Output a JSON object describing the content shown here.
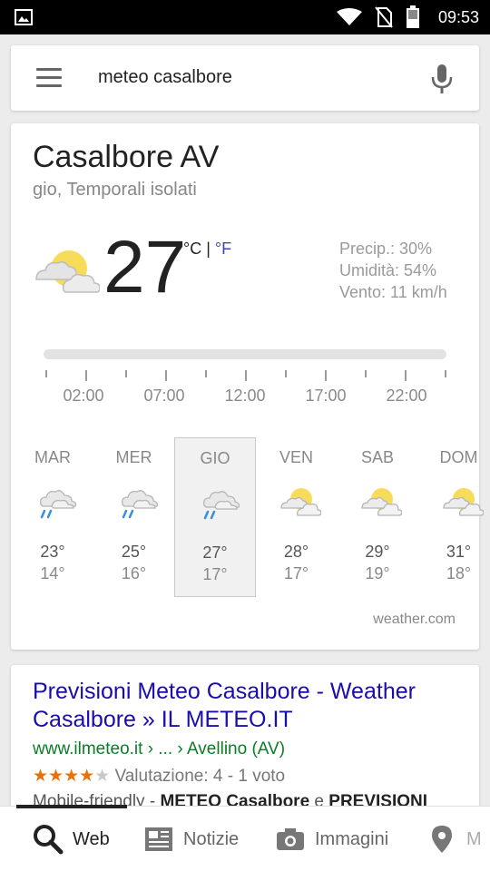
{
  "status": {
    "time": "09:53"
  },
  "search": {
    "query": "meteo casalbore"
  },
  "weather": {
    "location": "Casalbore AV",
    "condition": "gio, Temporali isolati",
    "temp": "27",
    "unit_c": "°C",
    "unit_sep": " | ",
    "unit_f": "°F",
    "precip": "Precip.: 30%",
    "humidity": "Umidità: 54%",
    "wind": "Vento: 11 km/h",
    "timeline": [
      "02:00",
      "07:00",
      "12:00",
      "17:00",
      "22:00"
    ],
    "days": [
      {
        "name": "MAR",
        "hi": "23°",
        "lo": "14°",
        "icon": "rain-cloud-icon"
      },
      {
        "name": "MER",
        "hi": "25°",
        "lo": "16°",
        "icon": "rain-cloud-icon"
      },
      {
        "name": "GIO",
        "hi": "27°",
        "lo": "17°",
        "icon": "rain-cloud-icon"
      },
      {
        "name": "VEN",
        "hi": "28°",
        "lo": "17°",
        "icon": "partly-cloudy-icon"
      },
      {
        "name": "SAB",
        "hi": "29°",
        "lo": "19°",
        "icon": "partly-cloudy-icon"
      },
      {
        "name": "DOM",
        "hi": "31°",
        "lo": "18°",
        "icon": "partly-cloudy-icon"
      }
    ],
    "selected_day": "GIO",
    "source": "weather.com"
  },
  "result": {
    "title": "Previsioni Meteo Casalbore - Weather Casalbore » IL METEO.IT",
    "url": "www.ilmeteo.it › ... › Avellino (AV)",
    "stars_on": "★★★★",
    "stars_off": "★",
    "rating_text": "Valutazione: 4 - 1 voto",
    "snippet_pre": "Mobile-friendly - ",
    "snippet_bold1": "METEO Casalbore",
    "snippet_mid": " e ",
    "snippet_bold2": "PREVISIONI"
  },
  "nav": [
    {
      "label": "Web",
      "icon": "search-icon"
    },
    {
      "label": "Notizie",
      "icon": "newspaper-icon"
    },
    {
      "label": "Immagini",
      "icon": "camera-icon"
    },
    {
      "label": "M",
      "icon": "map-pin-icon"
    }
  ],
  "colors": {
    "link": "#1a0dab",
    "url": "#0b7d26",
    "star": "#e8710a",
    "sun": "#f7dc5c"
  }
}
